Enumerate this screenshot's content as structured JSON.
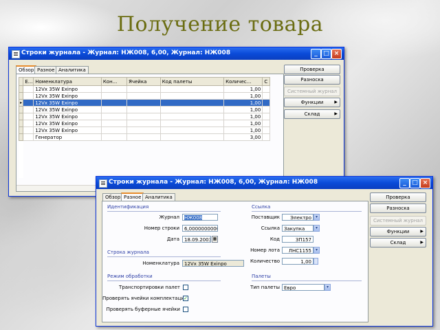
{
  "slide_title": "Получение товара",
  "window1": {
    "title": "Строки журнала - Журнал: НЖ008, 6,00, Журнал: НЖ008",
    "tabs": [
      "Обзор",
      "Разное",
      "Аналитика"
    ],
    "columns": [
      "Е...",
      "Номенклатура",
      "Кон...",
      "Ячейка",
      "Код палеты",
      "Количес...",
      "С"
    ],
    "rows": [
      {
        "item": "12Vx 35W Exinpo",
        "qty": "1,00"
      },
      {
        "item": "12Vx 35W Exinpo",
        "qty": "1,00"
      },
      {
        "item": "12Vx 35W Exinpo",
        "qty": "1,00"
      },
      {
        "item": "12Vx 35W Exinpo",
        "qty": "1,00"
      },
      {
        "item": "12Vx 35W Exinpo",
        "qty": "1,00"
      },
      {
        "item": "12Vx 35W Exinpo",
        "qty": "1,00"
      },
      {
        "item": "12Vx 35W Exinpo",
        "qty": "1,00"
      },
      {
        "item": "Генератор",
        "qty": "3,00"
      }
    ],
    "selected_row": 2,
    "row_marker": "▸",
    "buttons": {
      "check": "Проверка",
      "post": "Разноска",
      "system_journal": "Системный журнал",
      "functions": "Функции",
      "warehouse": "Склад"
    }
  },
  "window2": {
    "title": "Строки журнала - Журнал: НЖ008, 6,00, Журнал: НЖ008",
    "tabs": [
      "Обзор",
      "Разное",
      "Аналитика"
    ],
    "buttons": {
      "check": "Проверка",
      "post": "Разноска",
      "system_journal": "Системный журнал",
      "functions": "Функции",
      "warehouse": "Склад"
    },
    "identification": {
      "group": "Идентификация",
      "journal_label": "Журнал",
      "journal_value": "НЖ008",
      "line_label": "Номер строки",
      "line_value": "6,0000000000",
      "date_label": "Дата",
      "date_value": "18.09.2003"
    },
    "journal_line": {
      "group": "Строка журнала",
      "item_label": "Номенклатура",
      "item_value": "12Vx 35W Exinpo"
    },
    "processing": {
      "group": "Режим обработки",
      "transport_label": "Транспортировки палет",
      "transport_checked": false,
      "verify_label": "Проверять ячейки комплектации",
      "verify_checked": true,
      "buffer_label": "Проверять буферные ячейки",
      "buffer_checked": false
    },
    "reference": {
      "group": "Ссылка",
      "supplier_label": "Поставщик",
      "supplier_value": "Электро",
      "ref_label": "Ссылка",
      "ref_value": "Закупка",
      "code_label": "Код",
      "code_value": "ЗП157",
      "lot_label": "Номер лота",
      "lot_value": "ЛНС1155",
      "qty_label": "Количество",
      "qty_value": "1,00"
    },
    "pallets": {
      "group": "Палеты",
      "type_label": "Тип палеты",
      "type_value": "Евро"
    }
  }
}
